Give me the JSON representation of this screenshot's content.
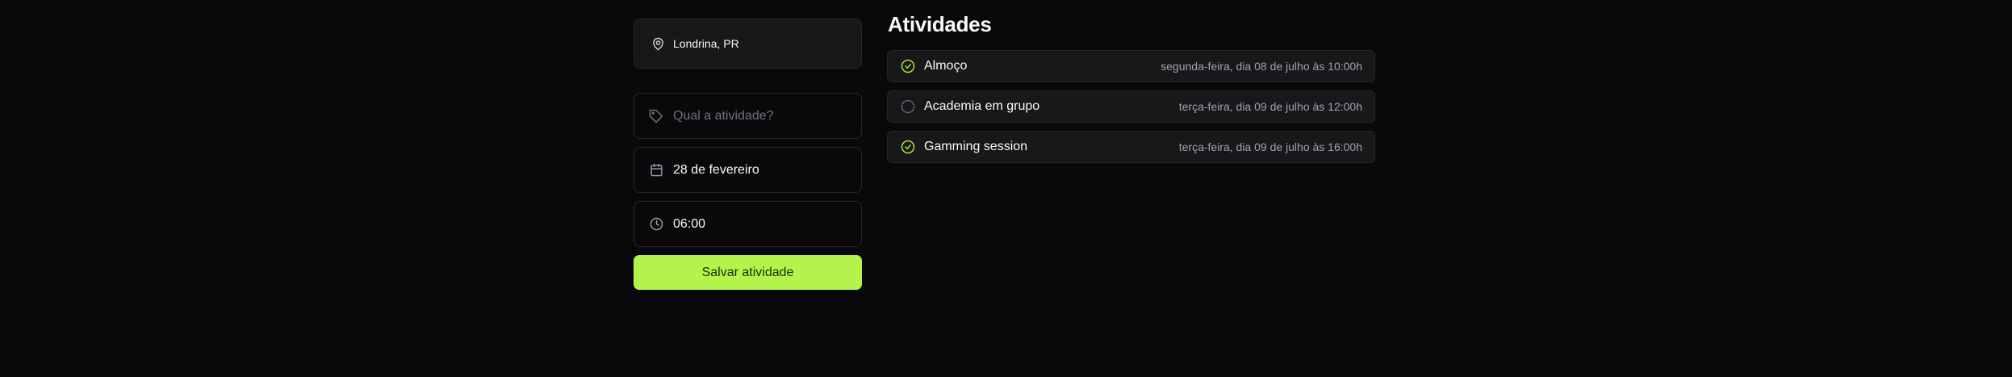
{
  "location": {
    "label": "Londrina, PR",
    "icon": "map-pin-icon"
  },
  "form": {
    "activity_placeholder": "Qual a atividade?",
    "date_value": "28 de fevereiro",
    "time_value": "06:00",
    "save_label": "Salvar atividade"
  },
  "activities": {
    "title": "Atividades",
    "items": [
      {
        "name": "Almoço",
        "when": "segunda-feira, dia 08 de julho às 10:00h",
        "done": true
      },
      {
        "name": "Academia em grupo",
        "when": "terça-feira, dia 09 de julho às 12:00h",
        "done": false
      },
      {
        "name": "Gamming session",
        "when": "terça-feira, dia 09 de julho às 16:00h",
        "done": true
      }
    ]
  },
  "colors": {
    "accent": "#b4f34b",
    "background": "#09090b",
    "card": "#18181b",
    "border": "#27272a"
  }
}
